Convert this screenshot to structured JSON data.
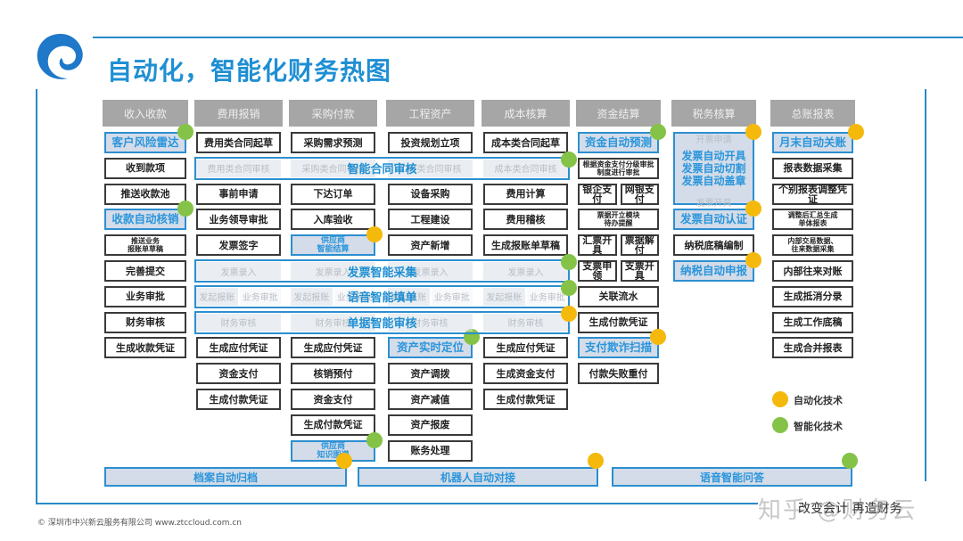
{
  "title": "自动化，智能化财务热图",
  "colors": {
    "accent": "#1f8fd3",
    "auto": "#f5b90c",
    "smart": "#84c347",
    "header_gray": "#a6a6a6",
    "highlight_fill": "#d3dce8"
  },
  "columns": [
    {
      "header": "收入收款",
      "items": [
        {
          "label": "客户风险雷达",
          "type": "highlight",
          "badge": "smart"
        },
        {
          "label": "收到款项",
          "type": "normal"
        },
        {
          "label": "推送收款池",
          "type": "normal"
        },
        {
          "label": "收款自动核销",
          "type": "highlight",
          "badge": "smart"
        },
        {
          "label": "推送业务\n报账单草稿",
          "type": "normal"
        },
        {
          "label": "完善提交",
          "type": "normal"
        },
        {
          "label": "业务审批",
          "type": "normal"
        },
        {
          "label": "财务审核",
          "type": "normal"
        },
        {
          "label": "生成收款凭证",
          "type": "normal"
        }
      ]
    },
    {
      "header": "费用报销",
      "items": [
        {
          "label": "费用类合同起草",
          "type": "normal"
        },
        {
          "label": "费用类合同审核",
          "type": "ghost"
        },
        {
          "label": "事前申请",
          "type": "normal"
        },
        {
          "label": "业务领导审批",
          "type": "normal"
        },
        {
          "label": "发票签字",
          "type": "normal"
        },
        {
          "label": "发票录入",
          "type": "ghost"
        },
        {
          "label": "发起报账",
          "type": "ghost"
        },
        {
          "label": "业务审批",
          "type": "ghost"
        },
        {
          "label": "财务审核",
          "type": "ghost"
        },
        {
          "label": "生成应付凭证",
          "type": "normal"
        },
        {
          "label": "资金支付",
          "type": "normal"
        },
        {
          "label": "生成付款凭证",
          "type": "normal"
        }
      ]
    },
    {
      "header": "采购付款",
      "items": [
        {
          "label": "采购需求预测",
          "type": "normal"
        },
        {
          "label": "采购类合同审核",
          "type": "ghost"
        },
        {
          "label": "下达订单",
          "type": "normal"
        },
        {
          "label": "入库验收",
          "type": "normal"
        },
        {
          "label": "供应商\n智能结算",
          "type": "highlight",
          "badge": "auto"
        },
        {
          "label": "发票录入",
          "type": "ghost"
        },
        {
          "label": "发起报账",
          "type": "ghost"
        },
        {
          "label": "业务审批",
          "type": "ghost"
        },
        {
          "label": "财务审核",
          "type": "ghost"
        },
        {
          "label": "生成应付凭证",
          "type": "normal"
        },
        {
          "label": "核销预付",
          "type": "normal"
        },
        {
          "label": "资金支付",
          "type": "normal"
        },
        {
          "label": "生成付款凭证",
          "type": "normal"
        },
        {
          "label": "供应商\n知识图谱",
          "type": "highlight",
          "badge": "smart"
        }
      ]
    },
    {
      "header": "工程资产",
      "items": [
        {
          "label": "投资规划立项",
          "type": "normal"
        },
        {
          "label": "工程类合同审核",
          "type": "ghost"
        },
        {
          "label": "设备采购",
          "type": "normal"
        },
        {
          "label": "工程建设",
          "type": "normal"
        },
        {
          "label": "资产新增",
          "type": "normal"
        },
        {
          "label": "发票录入",
          "type": "ghost"
        },
        {
          "label": "发起报账",
          "type": "ghost"
        },
        {
          "label": "业务审批",
          "type": "ghost"
        },
        {
          "label": "财务审核",
          "type": "ghost"
        },
        {
          "label": "资产实时定位",
          "type": "highlight",
          "badge": "smart"
        },
        {
          "label": "资产调拨",
          "type": "normal"
        },
        {
          "label": "资产减值",
          "type": "normal"
        },
        {
          "label": "资产报废",
          "type": "normal"
        },
        {
          "label": "账务处理",
          "type": "normal"
        }
      ]
    },
    {
      "header": "成本核算",
      "items": [
        {
          "label": "成本类合同起草",
          "type": "normal"
        },
        {
          "label": "成本类合同审核",
          "type": "ghost"
        },
        {
          "label": "费用计算",
          "type": "normal"
        },
        {
          "label": "费用稽核",
          "type": "normal"
        },
        {
          "label": "生成报账单草稿",
          "type": "normal"
        },
        {
          "label": "发票录入",
          "type": "ghost"
        },
        {
          "label": "发起报账",
          "type": "ghost"
        },
        {
          "label": "业务审批",
          "type": "ghost"
        },
        {
          "label": "财务审核",
          "type": "ghost"
        },
        {
          "label": "生成应付凭证",
          "type": "normal"
        },
        {
          "label": "生成资金支付",
          "type": "normal"
        },
        {
          "label": "生成付款凭证",
          "type": "normal"
        }
      ]
    },
    {
      "header": "资金结算",
      "items": [
        {
          "label": "资金自动预测",
          "type": "highlight",
          "badge": "smart"
        },
        {
          "label": "根据资金支付分级审批\n制度进行审批",
          "type": "normal"
        },
        {
          "label": "银企支付",
          "type": "normal"
        },
        {
          "label": "网银支付",
          "type": "normal"
        },
        {
          "label": "票据开立模块\n待办提醒",
          "type": "normal"
        },
        {
          "label": "汇票开具",
          "type": "normal"
        },
        {
          "label": "票据解付",
          "type": "normal"
        },
        {
          "label": "支票申领",
          "type": "normal"
        },
        {
          "label": "支票开具",
          "type": "normal"
        },
        {
          "label": "关联流水",
          "type": "normal"
        },
        {
          "label": "生成付款凭证",
          "type": "normal"
        },
        {
          "label": "支付欺诈扫描",
          "type": "highlight",
          "badge": "auto"
        },
        {
          "label": "付款失败重付",
          "type": "normal"
        }
      ]
    },
    {
      "header": "税务核算",
      "items": [
        {
          "label": "开票申请",
          "type": "ghost"
        },
        {
          "label": "发票自动开具\n发票自动切割\n发票自动盖章",
          "type": "highlight",
          "badge": "auto"
        },
        {
          "label": "发票开具",
          "type": "ghost"
        },
        {
          "label": "发票自动认证",
          "type": "highlight",
          "badge": "auto"
        },
        {
          "label": "纳税底稿编制",
          "type": "normal"
        },
        {
          "label": "纳税自动申报",
          "type": "highlight",
          "badge": "auto"
        }
      ]
    },
    {
      "header": "总账报表",
      "items": [
        {
          "label": "月末自动关账",
          "type": "highlight",
          "badge": "auto"
        },
        {
          "label": "报表数据采集",
          "type": "normal"
        },
        {
          "label": "个别报表调整凭证",
          "type": "normal"
        },
        {
          "label": "调整后汇总生成\n单体报表",
          "type": "normal"
        },
        {
          "label": "内部交易数据、\n往来数据采集",
          "type": "normal"
        },
        {
          "label": "内部往来对账",
          "type": "normal"
        },
        {
          "label": "生成抵消分录",
          "type": "normal"
        },
        {
          "label": "生成工作底稿",
          "type": "normal"
        },
        {
          "label": "生成合并报表",
          "type": "normal"
        }
      ]
    }
  ],
  "bands": [
    {
      "label": "智能合同审核",
      "badge": "smart"
    },
    {
      "label": "发票智能采集",
      "badge": "smart"
    },
    {
      "label": "语音智能填单",
      "badge": "smart"
    },
    {
      "label": "单据智能审核",
      "badge": "auto"
    }
  ],
  "bottom_bars": [
    {
      "label": "档案自动归档",
      "badge": "auto"
    },
    {
      "label": "机器人自动对接",
      "badge": "auto"
    },
    {
      "label": "语音智能问答",
      "badge": "smart"
    }
  ],
  "legend": [
    {
      "label": "自动化技术",
      "type": "auto"
    },
    {
      "label": "智能化技术",
      "type": "smart"
    }
  ],
  "footer": "© 深圳市中兴新云服务有限公司   www.ztccloud.com.cn",
  "watermark": "知乎 @财务云",
  "watermark_sub": "改变会计 再造财务"
}
